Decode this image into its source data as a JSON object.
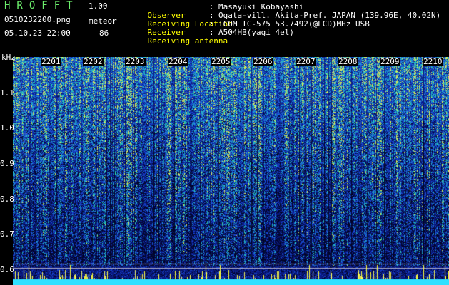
{
  "header": {
    "app_name": "HROFFT",
    "version": "1.00",
    "filename": "0510232200.png",
    "datetime": "05.10.23 22:00",
    "meteor_label": "meteor",
    "meteor_count": "86",
    "info": [
      {
        "label": "Observer",
        "value": "Masayuki Kobayashi"
      },
      {
        "label": "Receiving Location",
        "value": "Ogata-vill. Akita-Pref. JAPAN (139.96E, 40.02N)"
      },
      {
        "label": "Receiver",
        "value": "ICOM IC-575 53.7492(@LCD)MHz USB"
      },
      {
        "label": "Receiving antenna",
        "value": "A504HB(yagi 4el)"
      }
    ]
  },
  "spectrogram": {
    "y_unit": "kHz",
    "y_ticks": [
      "1.1",
      "1.0",
      "0.9",
      "0.8",
      "0.7",
      "0.6"
    ],
    "x_ticks": [
      "2201",
      "2202",
      "2203",
      "2204",
      "2205",
      "2206",
      "2207",
      "2208",
      "2209",
      "2210"
    ],
    "colors": {
      "background": "#000000",
      "deep": "#0a1a6e",
      "mid": "#1e4fd8",
      "high": "#30d0c0",
      "peak": "#ffff40",
      "baseline": "#30e0ff"
    }
  }
}
